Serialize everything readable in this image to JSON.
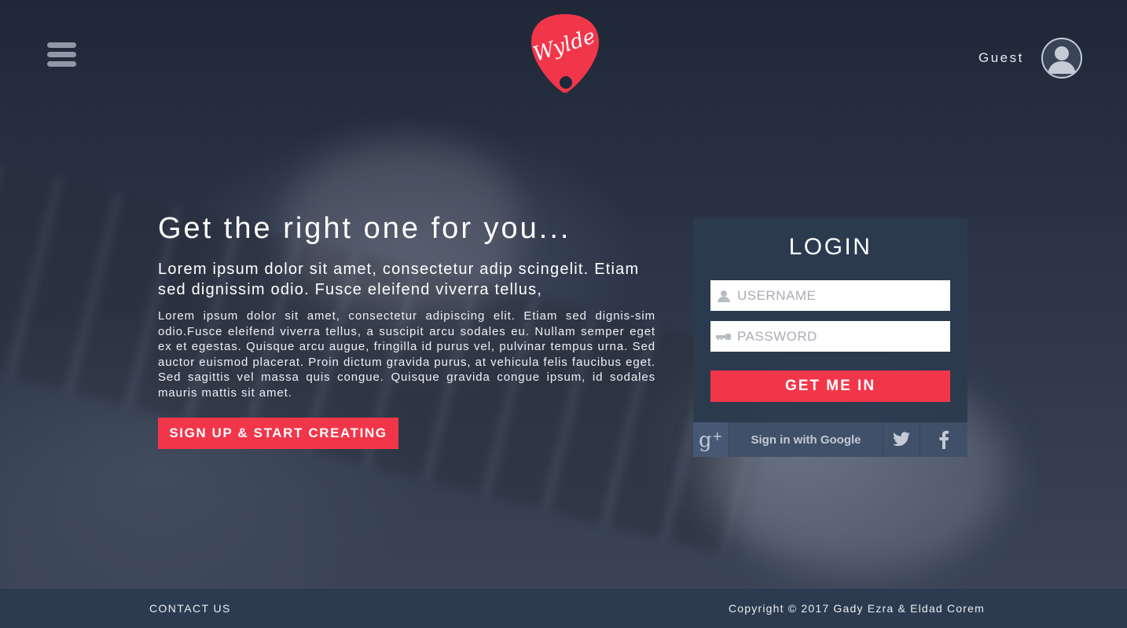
{
  "brand": {
    "logo_text": "Wylde",
    "accent_color": "#f2364a"
  },
  "header": {
    "menu_icon": "hamburger-icon",
    "user_label": "Guest",
    "avatar_icon": "user-avatar-icon"
  },
  "hero": {
    "title": "Get the right one for you...",
    "subtitle": "Lorem ipsum dolor sit amet, consectetur adip scingelit. Etiam sed dignissim odio. Fusce eleifend viverra tellus,",
    "body": "Lorem ipsum dolor sit amet, consectetur adipiscing elit. Etiam sed dignis-sim odio.Fusce eleifend viverra tellus, a suscipit arcu sodales eu. Nullam semper eget ex et egestas. Quisque arcu augue, fringilla id purus vel, pulvinar tempus urna. Sed auctor euismod placerat. Proin dictum gravida purus, at vehicula felis faucibus eget. Sed sagittis vel massa quis congue. Quisque gravida congue ipsum, id sodales mauris mattis sit amet.",
    "cta_label": "SIGN UP & START CREATING"
  },
  "login": {
    "title": "LOGIN",
    "username_placeholder": "USERNAME",
    "username_value": "",
    "password_placeholder": "PASSWORD",
    "password_value": "",
    "submit_label": "GET ME IN",
    "google_label": "Sign in with Google",
    "icons": [
      "google-plus-icon",
      "twitter-icon",
      "facebook-icon"
    ]
  },
  "footer": {
    "contact_label": "CONTACT US",
    "copyright": "Copyright © 2017 Gady Ezra & Eldad Corem"
  }
}
